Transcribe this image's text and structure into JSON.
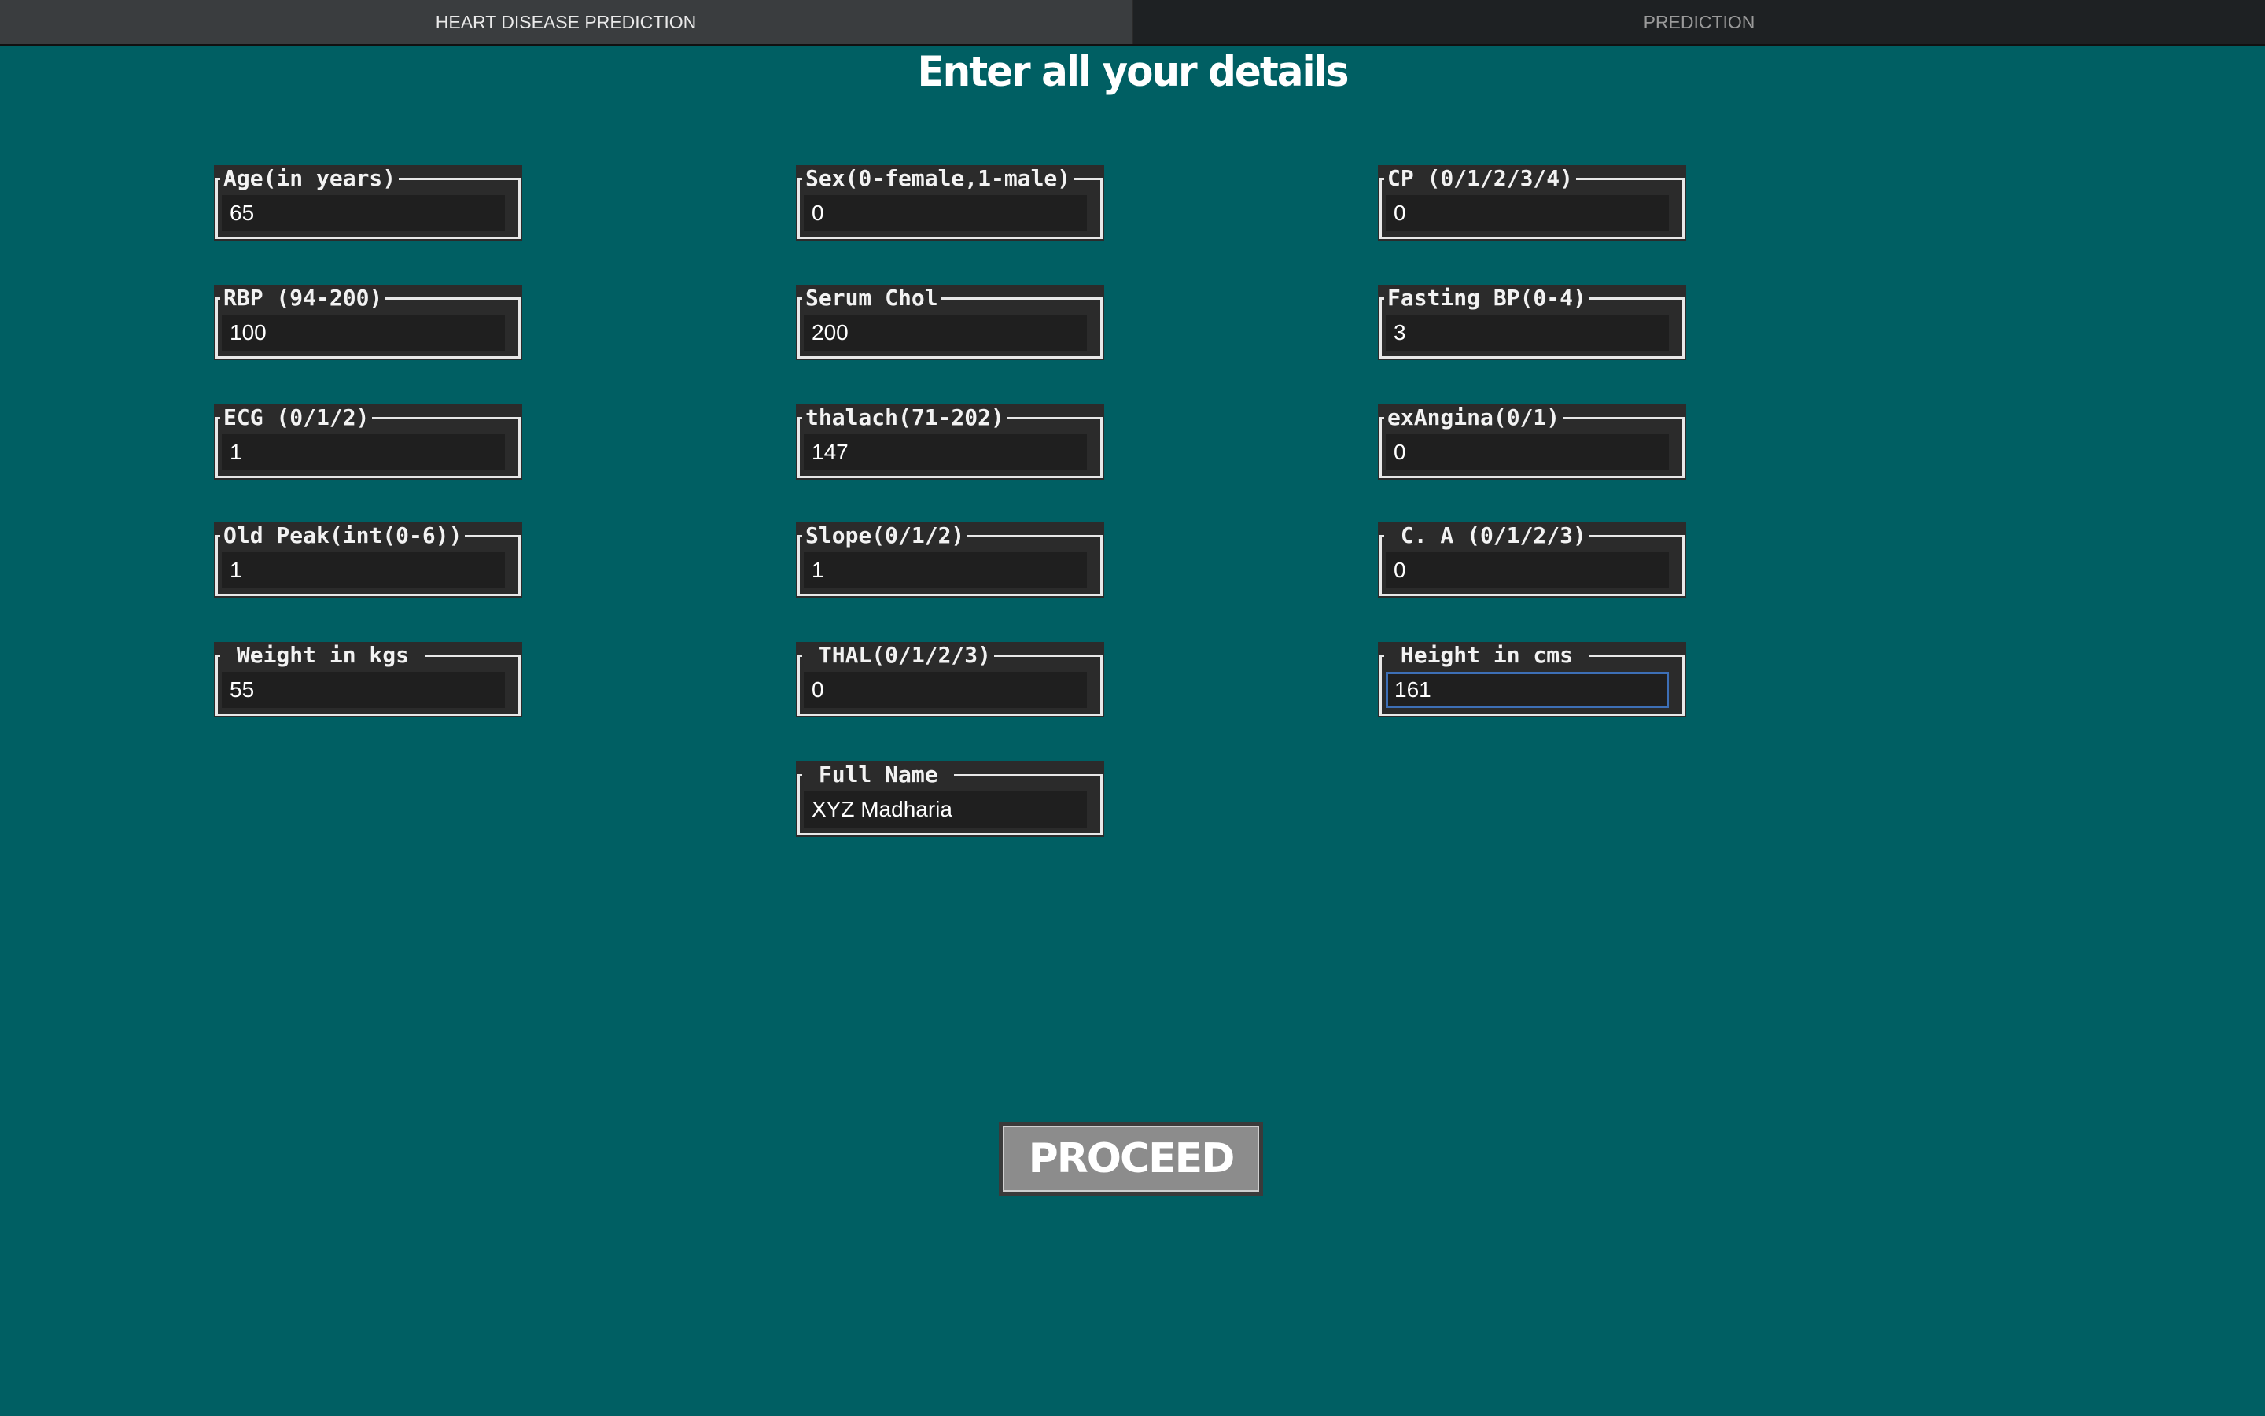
{
  "tabs": [
    {
      "label": "HEART DISEASE PREDICTION",
      "active": true
    },
    {
      "label": "PREDICTION",
      "active": false
    }
  ],
  "heading": "Enter all your details",
  "fields": {
    "age": {
      "label": "Age(in years)",
      "value": "65"
    },
    "sex": {
      "label": "Sex(0-female,1-male)",
      "value": "0"
    },
    "cp": {
      "label": "CP (0/1/2/3/4)",
      "value": "0"
    },
    "rbp": {
      "label": "RBP (94-200)",
      "value": "100"
    },
    "serum_chol": {
      "label": "Serum Chol",
      "value": "200"
    },
    "fasting_bp": {
      "label": "Fasting BP(0-4)",
      "value": "3"
    },
    "ecg": {
      "label": "ECG (0/1/2)",
      "value": "1"
    },
    "thalach": {
      "label": "thalach(71-202)",
      "value": "147"
    },
    "exangina": {
      "label": "exAngina(0/1)",
      "value": "0"
    },
    "old_peak": {
      "label": "Old Peak(int(0-6))",
      "value": "1"
    },
    "slope": {
      "label": "Slope(0/1/2)",
      "value": "1"
    },
    "ca": {
      "label": " C. A (0/1/2/3)",
      "value": "0"
    },
    "weight": {
      "label": " Weight in kgs ",
      "value": "55"
    },
    "thal": {
      "label": " THAL(0/1/2/3)",
      "value": "0"
    },
    "height": {
      "label": " Height in cms ",
      "value": "161"
    },
    "full_name": {
      "label": " Full Name ",
      "value": "XYZ Madharia"
    }
  },
  "proceed_label": "PROCEED",
  "colors": {
    "background": "#005f63",
    "field_bg": "#2b2b2b",
    "focus_border": "#3d6fb6",
    "button_bg": "#8c8c8c"
  }
}
